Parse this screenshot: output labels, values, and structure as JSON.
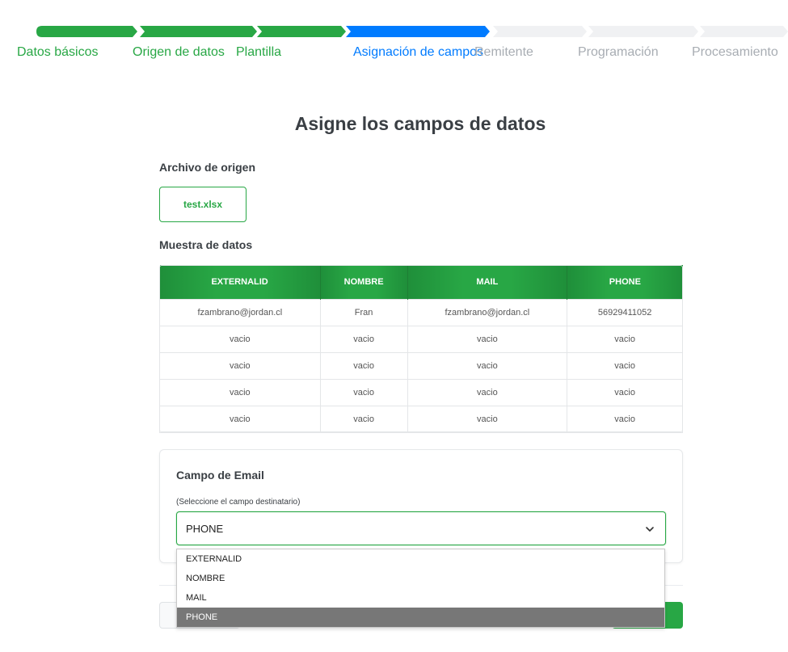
{
  "stepper": {
    "steps": [
      {
        "label": "Datos básicos",
        "state": "done"
      },
      {
        "label": "Origen de datos",
        "state": "done"
      },
      {
        "label": "Plantilla",
        "state": "done"
      },
      {
        "label": "Asignación de campos",
        "state": "active"
      },
      {
        "label": "Remitente",
        "state": "pending"
      },
      {
        "label": "Programación",
        "state": "pending"
      },
      {
        "label": "Procesamiento",
        "state": "pending"
      }
    ],
    "colors": {
      "done": "#28a745",
      "active": "#007bff",
      "pending": "#f0f1f3",
      "pending_text": "#a8adb3"
    }
  },
  "page": {
    "title": "Asigne los campos de datos"
  },
  "source": {
    "label": "Archivo de origen",
    "file_name": "test.xlsx"
  },
  "sample": {
    "label": "Muestra de datos",
    "columns": [
      "EXTERNALID",
      "NOMBRE",
      "MAIL",
      "PHONE"
    ],
    "rows": [
      [
        "fzambrano@jordan.cl",
        "Fran",
        "fzambrano@jordan.cl",
        "56929411052"
      ],
      [
        "vacio",
        "vacio",
        "vacio",
        "vacio"
      ],
      [
        "vacio",
        "vacio",
        "vacio",
        "vacio"
      ],
      [
        "vacio",
        "vacio",
        "vacio",
        "vacio"
      ],
      [
        "vacio",
        "vacio",
        "vacio",
        "vacio"
      ]
    ]
  },
  "email_field": {
    "title": "Campo de Email",
    "hint": "(Seleccione el campo destinatario)",
    "selected": "PHONE",
    "options": [
      "EXTERNALID",
      "NOMBRE",
      "MAIL",
      "PHONE"
    ]
  },
  "colors": {
    "accent": "#28a745",
    "primary": "#007bff"
  }
}
